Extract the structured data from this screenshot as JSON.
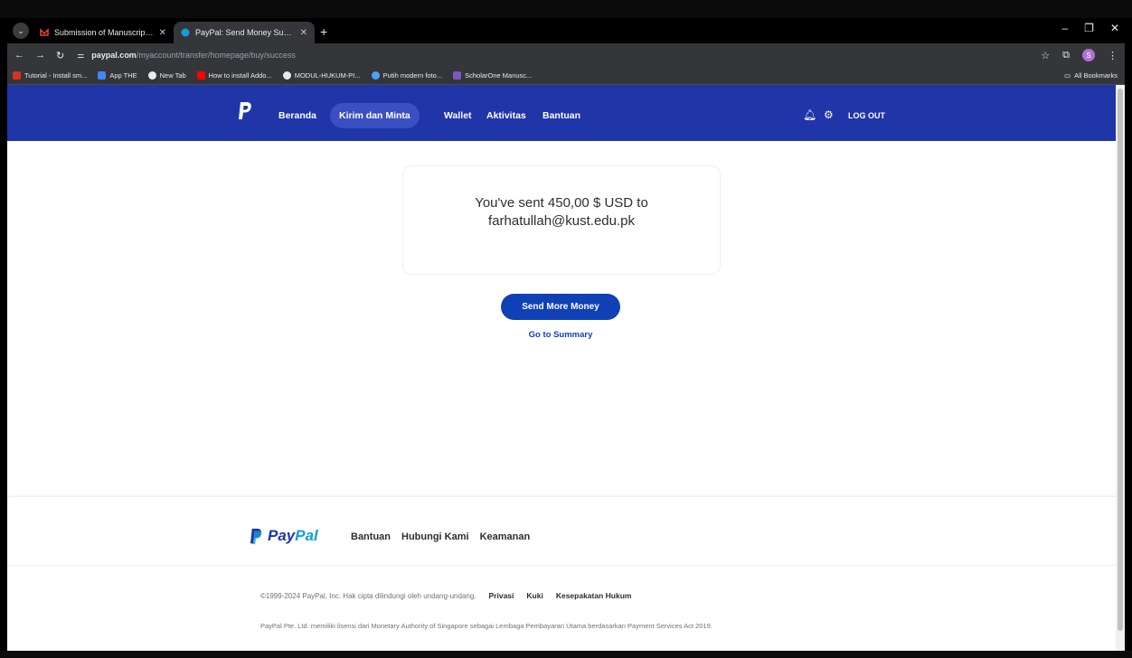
{
  "browser": {
    "tabs": [
      {
        "title": "Submission of Manuscript and",
        "favicon_color": "#ea4335",
        "active": false
      },
      {
        "title": "PayPal: Send Money Success",
        "favicon_color": "#179bd7",
        "active": true
      }
    ],
    "new_tab_label": "+",
    "url_host": "paypal.com",
    "url_path": "/myaccount/transfer/homepage/buy/success",
    "bookmarks": [
      {
        "label": "Tutorial - Install sm...",
        "color": "#d93025"
      },
      {
        "label": "App THE",
        "color": "#4285f4"
      },
      {
        "label": "New Tab",
        "color": "#e8eaed"
      },
      {
        "label": "How to install Addo...",
        "color": "#ff0000"
      },
      {
        "label": "MODUL-HUKUM-PI...",
        "color": "#e8eaed"
      },
      {
        "label": "Putih modern foto...",
        "color": "#4ea1ff"
      },
      {
        "label": "ScholarOne Manusc...",
        "color": "#7e57c2"
      }
    ],
    "all_bookmarks_label": "All Bookmarks",
    "profile_initial": "S"
  },
  "header": {
    "nav": [
      "Beranda",
      "Kirim dan Minta",
      "Wallet",
      "Aktivitas",
      "Bantuan"
    ],
    "active_nav": "Kirim dan Minta",
    "logout_label": "LOG OUT",
    "brand_color": "#1f35a8"
  },
  "main": {
    "message_line1": "You've sent 450,00 $ USD to",
    "message_line2": "farhatullah@kust.edu.pk",
    "primary_button": "Send More Money",
    "summary_link": "Go to Summary",
    "accent_color": "#1040b5"
  },
  "footer": {
    "wordmark_pay": "Pay",
    "wordmark_pal": "Pal",
    "links": [
      "Bantuan",
      "Hubungi Kami",
      "Keamanan"
    ],
    "copyright": "©1999-2024 PayPal, Inc. Hak cipta dilindungi oleh undang-undang.",
    "legal_links": [
      "Privasi",
      "Kuki",
      "Kesepakatan Hukum"
    ],
    "license": "PayPal Pte. Ltd. memiliki lisensi dari Monetary Authority of Singapore sebagai Lembaga Pembayaran Utama berdasarkan Payment Services Act 2019."
  }
}
